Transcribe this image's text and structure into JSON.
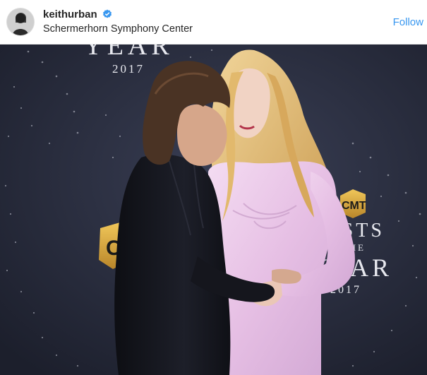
{
  "header": {
    "username": "keithurban",
    "verified": true,
    "location": "Schermerhorn Symphony Center",
    "follow_label": "Follow"
  },
  "photo": {
    "backdrop_text": {
      "year_top": "YEAR",
      "year_number": "2017",
      "logo_small": "CMT",
      "logo_large": "CM",
      "title_line1": "ARTISTS",
      "title_line2": "OF THE",
      "title_line3": "YEAR",
      "title_year": "2017"
    }
  },
  "colors": {
    "link_blue": "#3897f0",
    "backdrop": "#24283a",
    "dress": "#e8c6e6",
    "hair": "#e8c27a",
    "suit": "#121318",
    "logo_gold": "#d9a93a"
  },
  "icons": {
    "verified": "verified-badge-icon",
    "avatar": "avatar"
  }
}
